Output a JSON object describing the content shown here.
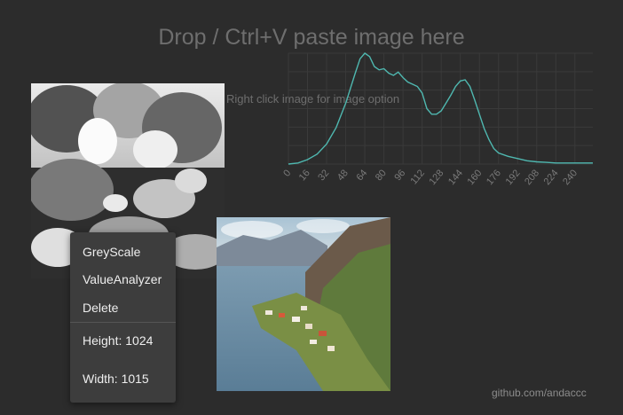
{
  "header": {
    "title": "Drop / Ctrl+V paste image here"
  },
  "hint": {
    "text": "Right click image for image option"
  },
  "context_menu": {
    "items": [
      "GreyScale",
      "ValueAnalyzer",
      "Delete"
    ],
    "height_text": "Height: 1024",
    "width_text": "Width: 1015"
  },
  "footer": {
    "link_text": "github.com/andaccc"
  },
  "colors": {
    "background": "#2c2c2c",
    "curve": "#4fb8b0",
    "grid": "#3a3a3a",
    "muted_text": "#6e6e6e",
    "menu_bg": "#3d3d3d"
  },
  "chart_data": {
    "type": "line",
    "title": "",
    "xlabel": "",
    "ylabel": "",
    "xlim": [
      0,
      255
    ],
    "ylim": [
      0,
      1
    ],
    "grid": true,
    "x_ticks": [
      "0",
      "16",
      "32",
      "48",
      "64",
      "80",
      "96",
      "112",
      "128",
      "144",
      "160",
      "176",
      "192",
      "208",
      "224",
      "240"
    ],
    "x": [
      0,
      8,
      16,
      24,
      32,
      40,
      48,
      56,
      60,
      64,
      68,
      72,
      76,
      80,
      84,
      88,
      92,
      96,
      100,
      104,
      108,
      112,
      116,
      120,
      124,
      128,
      132,
      136,
      140,
      144,
      148,
      152,
      156,
      160,
      164,
      168,
      172,
      176,
      184,
      192,
      200,
      208,
      216,
      224,
      232,
      240,
      248,
      255
    ],
    "values": [
      0.0,
      0.01,
      0.04,
      0.09,
      0.18,
      0.33,
      0.55,
      0.82,
      0.95,
      1.0,
      0.97,
      0.88,
      0.85,
      0.86,
      0.82,
      0.8,
      0.83,
      0.78,
      0.74,
      0.72,
      0.7,
      0.64,
      0.5,
      0.45,
      0.45,
      0.48,
      0.55,
      0.62,
      0.7,
      0.75,
      0.76,
      0.7,
      0.58,
      0.45,
      0.32,
      0.22,
      0.14,
      0.1,
      0.07,
      0.05,
      0.03,
      0.02,
      0.015,
      0.01,
      0.01,
      0.01,
      0.01,
      0.01
    ]
  }
}
